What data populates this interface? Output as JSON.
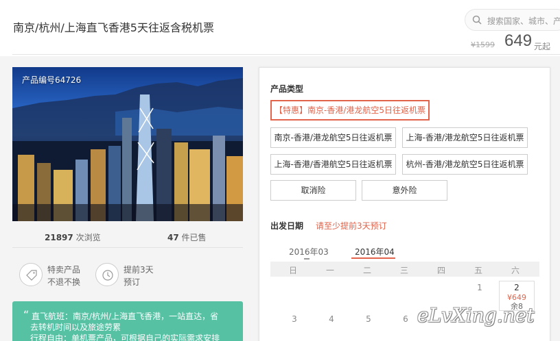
{
  "header": {
    "title": "南京/杭州/上海直飞香港5天往返含税机票",
    "search_placeholder": "搜索国家、城市、产",
    "price_original": "¥1599",
    "price_current": "649",
    "price_suffix": "元起"
  },
  "product": {
    "code": "产品编号64726",
    "views_count": "21897",
    "views_label": " 次浏览",
    "sold_count": "47",
    "sold_label": " 件已售",
    "features": [
      {
        "line1": "特卖产品",
        "line2": "不退不换",
        "icon": "tag-icon"
      },
      {
        "line1": "提前3天",
        "line2": "预订",
        "icon": "clock-icon"
      }
    ],
    "description": {
      "quote": "“",
      "line1": "直飞航班：南京/杭州/上海直飞香港，一站直达，省",
      "line2": "去转机时间以及旅途劳累",
      "line3": "行程自由：单机票产品，可根据自己的实际需求安排"
    }
  },
  "booking": {
    "type_label": "产品类型",
    "options": [
      "【特惠】南京-香港/港龙航空5日往返机票",
      "南京-香港/港龙航空5日往返机票",
      "上海-香港/港龙航空5日往返机票",
      "上海-香港/香港航空5日往返机票",
      "杭州-香港/港龙航空5日往返机票",
      "取消险",
      "意外险"
    ],
    "date_label": "出发日期",
    "date_hint": "请至少提前3天预订",
    "months": [
      "2016年03",
      "2016年04"
    ],
    "weekdays": [
      "日",
      "一",
      "二",
      "三",
      "四",
      "五",
      "六"
    ],
    "days": [
      "1",
      "2",
      "3",
      "4",
      "5",
      "6"
    ],
    "highlight_day": {
      "day": "2",
      "price": "¥649",
      "remaining": "余8"
    }
  },
  "watermark": "eLvXing.net",
  "colors": {
    "accent": "#e0634a",
    "teal": "#56c1a3"
  }
}
